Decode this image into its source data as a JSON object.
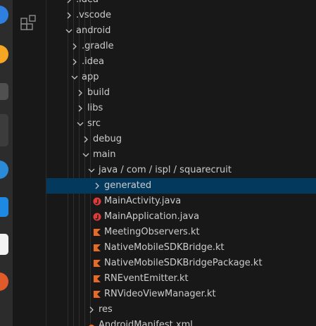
{
  "colors": {
    "tree_background": "#181818",
    "selection": "#04395e",
    "text": "#cccccc",
    "java_icon": "#e03b3b",
    "kotlin_icon": "#e86a25",
    "android_manifest_icon": "#e86a25"
  },
  "activity_bar": {
    "icon": "remote-explorer-icon"
  },
  "explorer": {
    "items": [
      {
        "label": ".idea",
        "type": "folder",
        "expanded": false,
        "depth": 1,
        "icon": "chevron-right"
      },
      {
        "label": ".vscode",
        "type": "folder",
        "expanded": false,
        "depth": 1,
        "icon": "chevron-right"
      },
      {
        "label": "android",
        "type": "folder",
        "expanded": true,
        "depth": 1,
        "icon": "chevron-down"
      },
      {
        "label": ".gradle",
        "type": "folder",
        "expanded": false,
        "depth": 2,
        "icon": "chevron-right"
      },
      {
        "label": ".idea",
        "type": "folder",
        "expanded": false,
        "depth": 2,
        "icon": "chevron-right"
      },
      {
        "label": "app",
        "type": "folder",
        "expanded": true,
        "depth": 2,
        "icon": "chevron-down"
      },
      {
        "label": "build",
        "type": "folder",
        "expanded": false,
        "depth": 3,
        "icon": "chevron-right"
      },
      {
        "label": "libs",
        "type": "folder",
        "expanded": false,
        "depth": 3,
        "icon": "chevron-right"
      },
      {
        "label": "src",
        "type": "folder",
        "expanded": true,
        "depth": 3,
        "icon": "chevron-down"
      },
      {
        "label": "debug",
        "type": "folder",
        "expanded": false,
        "depth": 4,
        "icon": "chevron-right"
      },
      {
        "label": "main",
        "type": "folder",
        "expanded": true,
        "depth": 4,
        "icon": "chevron-down"
      },
      {
        "label": "java / com / ispl / squarecruit",
        "type": "folder",
        "expanded": true,
        "depth": 5,
        "icon": "chevron-down"
      },
      {
        "label": "generated",
        "type": "folder",
        "expanded": false,
        "depth": 6,
        "icon": "chevron-right",
        "selected": true
      },
      {
        "label": "MainActivity.java",
        "type": "file",
        "depth": 6,
        "icon": "java-file-icon"
      },
      {
        "label": "MainApplication.java",
        "type": "file",
        "depth": 6,
        "icon": "java-file-icon"
      },
      {
        "label": "MeetingObservers.kt",
        "type": "file",
        "depth": 6,
        "icon": "kotlin-file-icon"
      },
      {
        "label": "NativeMobileSDKBridge.kt",
        "type": "file",
        "depth": 6,
        "icon": "kotlin-file-icon"
      },
      {
        "label": "NativeMobileSDKBridgePackage.kt",
        "type": "file",
        "depth": 6,
        "icon": "kotlin-file-icon"
      },
      {
        "label": "RNEventEmitter.kt",
        "type": "file",
        "depth": 6,
        "icon": "kotlin-file-icon"
      },
      {
        "label": "RNVideoViewManager.kt",
        "type": "file",
        "depth": 6,
        "icon": "kotlin-file-icon"
      },
      {
        "label": "res",
        "type": "folder",
        "expanded": false,
        "depth": 5,
        "icon": "chevron-right"
      },
      {
        "label": "AndroidManifest.xml",
        "type": "file",
        "depth": 5,
        "icon": "android-manifest-icon"
      }
    ]
  }
}
